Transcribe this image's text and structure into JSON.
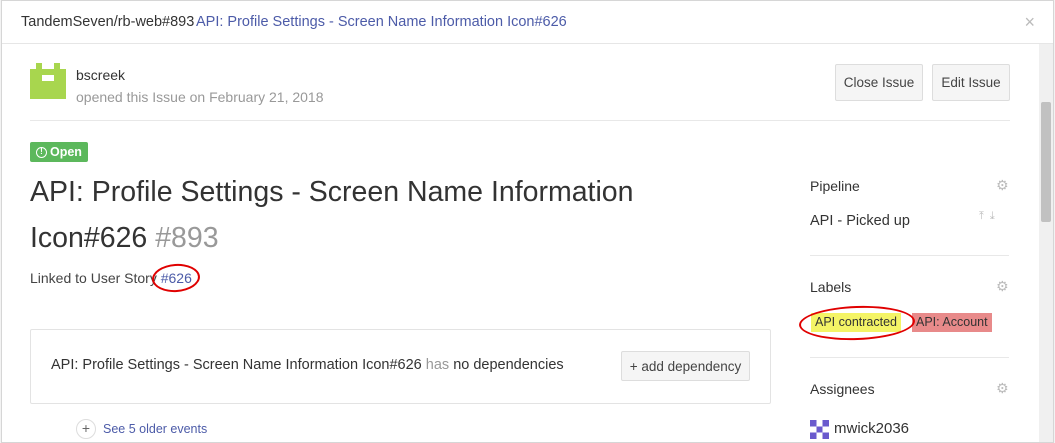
{
  "window": {
    "repo": "TandemSeven/rb-web#893",
    "title_link": "API: Profile Settings - Screen Name Information Icon#626",
    "close_glyph": "×"
  },
  "author": {
    "name": "bscreek",
    "opened_text": "opened this Issue on February 21, 2018",
    "avatar_icon": "green-pixel-avatar-icon",
    "avatar_color": "#a8d64e"
  },
  "actions": {
    "close_issue": "Close Issue",
    "edit_issue": "Edit Issue"
  },
  "issue": {
    "status": "Open",
    "title": "API: Profile Settings - Screen Name Information Icon#626",
    "number": "#893",
    "linked_prefix": "Linked to User Story ",
    "linked_story": "#626",
    "status_color": "#5cb85c"
  },
  "dependencies": {
    "issue_name": "API: Profile Settings - Screen Name Information Icon#626",
    "has": "has",
    "no_deps": "no dependencies",
    "add_button": "+ add dependency"
  },
  "timeline": {
    "older_events": "See 5 older events",
    "expand_glyph": "+"
  },
  "sidebar": {
    "pipeline_heading": "Pipeline",
    "pipeline_value": "API - Picked up",
    "pipeline_arrows": "⤒⤓",
    "labels_heading": "Labels",
    "labels": [
      {
        "text": "API contracted",
        "color": "#f4f466"
      },
      {
        "text": "API: Account",
        "color": "#e88a8a"
      }
    ],
    "assignees_heading": "Assignees",
    "assignee": "mwick2036",
    "gear_glyph": "⚙"
  },
  "annotation_color": "#e00000"
}
